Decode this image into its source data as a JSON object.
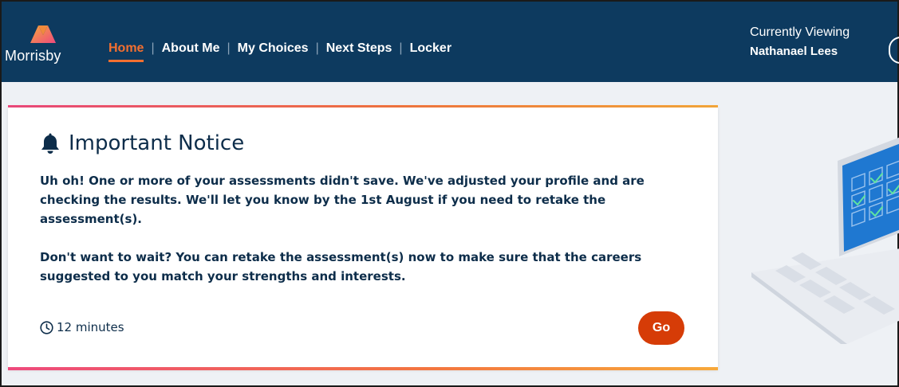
{
  "brand": {
    "name": "Morrisby"
  },
  "nav": {
    "items": [
      {
        "label": "Home",
        "active": true
      },
      {
        "label": "About Me",
        "active": false
      },
      {
        "label": "My Choices",
        "active": false
      },
      {
        "label": "Next Steps",
        "active": false
      },
      {
        "label": "Locker",
        "active": false
      }
    ],
    "separator": "|"
  },
  "viewer": {
    "label": "Currently Viewing",
    "name": "Nathanael Lees"
  },
  "notice": {
    "icon": "bell-icon",
    "title": "Important Notice",
    "paragraphs": [
      "Uh oh! One or more of your assessments didn't save. We've adjusted your profile and are checking the results. We'll let you know by the 1st August if you need to retake the assessment(s).",
      "Don't want to wait? You can retake the assessment(s) now to make sure that the careers suggested to you match your strengths and interests."
    ],
    "duration_icon": "clock-icon",
    "duration": "12 minutes",
    "action_label": "Go"
  },
  "colors": {
    "nav_bg": "#0d3a5f",
    "accent": "#f36f30",
    "go_button": "#d63c07",
    "text": "#0d2d4a",
    "gradient_start": "#ee4a7d",
    "gradient_end": "#f7a93b"
  }
}
